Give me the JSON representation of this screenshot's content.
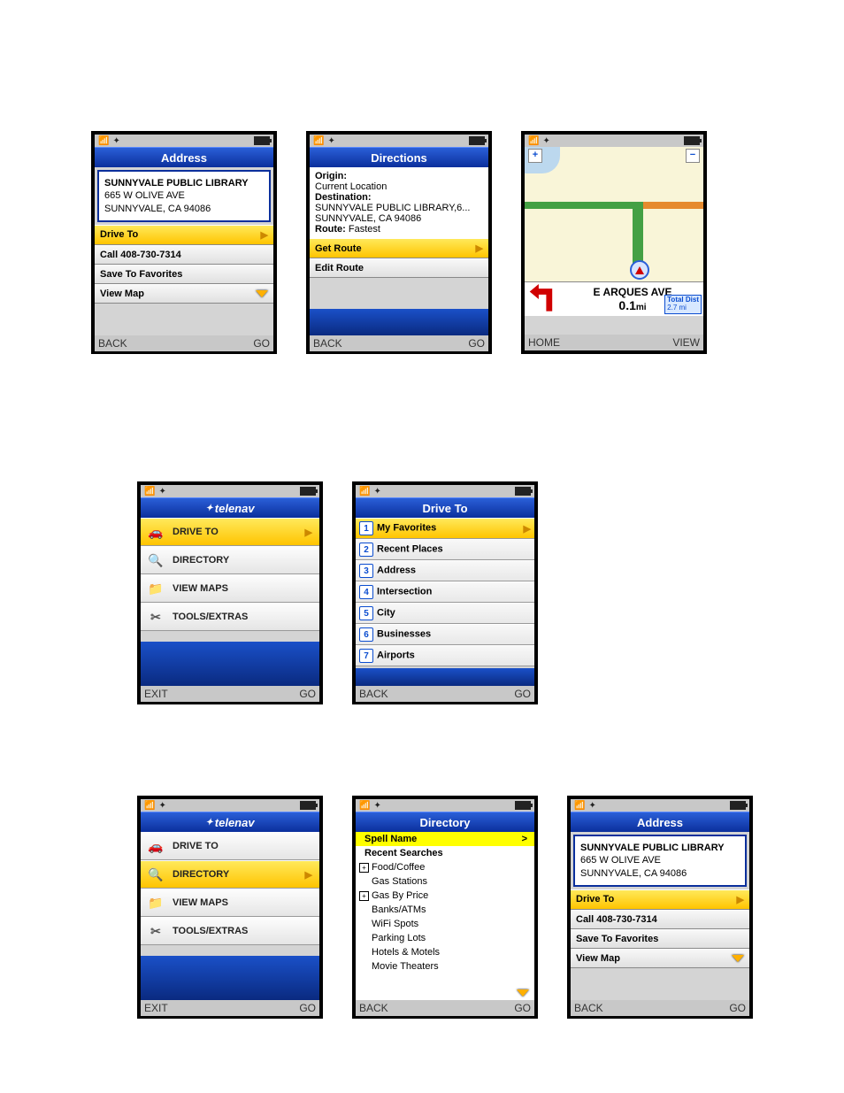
{
  "screen1": {
    "title": "Address",
    "place_name": "SUNNYVALE PUBLIC LIBRARY",
    "addr_line1": "665 W OLIVE AVE",
    "addr_line2": "SUNNYVALE, CA 94086",
    "row_drive": "Drive To",
    "row_call": "Call 408-730-7314",
    "row_save": "Save To Favorites",
    "row_map": "View Map",
    "sk_left": "BACK",
    "sk_right": "GO"
  },
  "screen2": {
    "title": "Directions",
    "origin_lbl": "Origin:",
    "origin_val": "Current Location",
    "dest_lbl": "Destination:",
    "dest_val1": "SUNNYVALE PUBLIC LIBRARY,6...",
    "dest_val2": "SUNNYVALE, CA 94086",
    "route_lbl": "Route:",
    "route_val": "Fastest",
    "row_get": "Get Route",
    "row_edit": "Edit Route",
    "sk_left": "BACK",
    "sk_right": "GO"
  },
  "screen3": {
    "street": "E ARQUES AVE",
    "dist": "0.1",
    "dist_unit": "mi",
    "total_lbl": "Total Dist",
    "total_val": "2.7 mi",
    "zoom_in": "+",
    "zoom_out": "−",
    "sk_left": "HOME",
    "sk_right": "VIEW"
  },
  "screen4": {
    "title": "telenav",
    "row1": "DRIVE TO",
    "row2": "DIRECTORY",
    "row3": "VIEW MAPS",
    "row4": "TOOLS/EXTRAS",
    "sk_left": "EXIT",
    "sk_right": "GO"
  },
  "screen5": {
    "title": "Drive To",
    "items": [
      "My Favorites",
      "Recent Places",
      "Address",
      "Intersection",
      "City",
      "Businesses",
      "Airports"
    ],
    "nums": [
      "1",
      "2",
      "3",
      "4",
      "5",
      "6",
      "7"
    ],
    "sk_left": "BACK",
    "sk_right": "GO"
  },
  "screen6": {
    "title": "telenav",
    "row1": "DRIVE TO",
    "row2": "DIRECTORY",
    "row3": "VIEW MAPS",
    "row4": "TOOLS/EXTRAS",
    "sk_left": "EXIT",
    "sk_right": "GO"
  },
  "screen7": {
    "title": "Directory",
    "spell": "Spell Name",
    "spell_arrow": ">",
    "recent": "Recent Searches",
    "cats": [
      "Food/Coffee",
      "Gas Stations",
      "Gas By Price",
      "Banks/ATMs",
      "WiFi Spots",
      "Parking Lots",
      "Hotels & Motels",
      "Movie Theaters"
    ],
    "sk_left": "BACK",
    "sk_right": "GO"
  },
  "screen8": {
    "title": "Address",
    "place_name": "SUNNYVALE PUBLIC LIBRARY",
    "addr_line1": "665 W OLIVE AVE",
    "addr_line2": "SUNNYVALE, CA 94086",
    "row_drive": "Drive To",
    "row_call": "Call 408-730-7314",
    "row_save": "Save To Favorites",
    "row_map": "View Map",
    "sk_left": "BACK",
    "sk_right": "GO"
  }
}
